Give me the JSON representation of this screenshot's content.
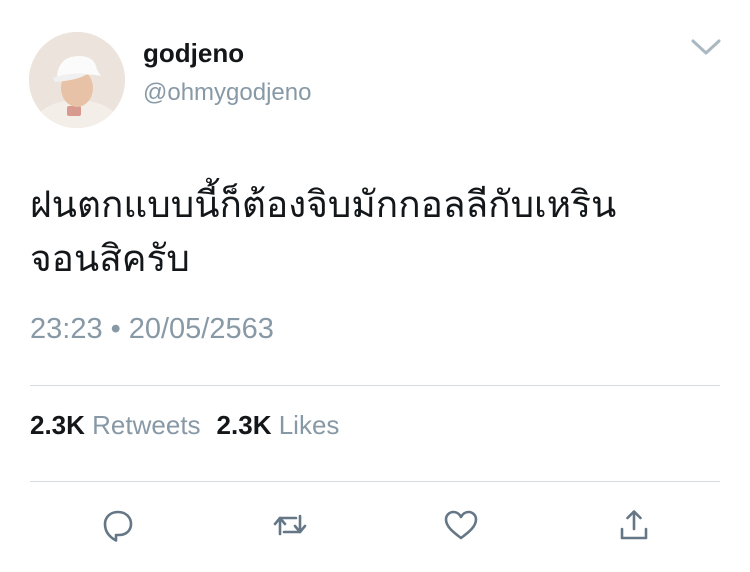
{
  "tweet": {
    "display_name": "godjeno",
    "handle": "@ohmygodjeno",
    "text_lines": [
      "ฝนตกแบบนี้ก็ต้องจิบมักกอลลีกับเหริน",
      "จอนสิครับ"
    ],
    "time": "23:23",
    "separator": "•",
    "date": "20/05/2563",
    "retweets_count": "2.3K",
    "retweets_label": "Retweets",
    "likes_count": "2.3K",
    "likes_label": "Likes"
  },
  "icons": {
    "menu": "chevron-down-icon",
    "reply": "reply-icon",
    "retweet": "retweet-icon",
    "like": "heart-icon",
    "share": "share-icon"
  },
  "colors": {
    "text": "#14171a",
    "secondary": "#8899a6",
    "divider": "#d6dbe0",
    "icon": "#657786"
  }
}
